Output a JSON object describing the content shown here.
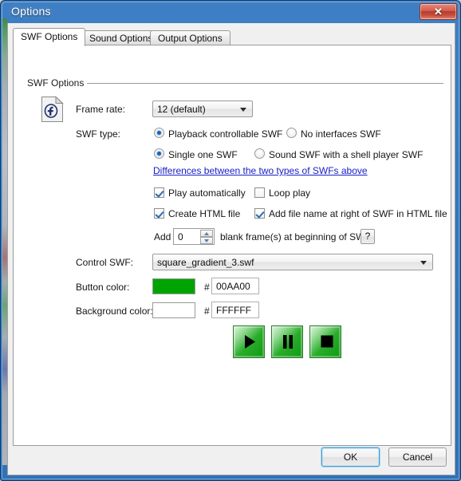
{
  "window": {
    "title": "Options",
    "close_label": "✕"
  },
  "tabs": [
    {
      "label": "SWF Options",
      "active": true
    },
    {
      "label": "Sound Options",
      "active": false
    },
    {
      "label": "Output Options",
      "active": false
    }
  ],
  "group": {
    "title": "SWF Options"
  },
  "frame_rate": {
    "label": "Frame rate:",
    "value": "12 (default)"
  },
  "swf_type": {
    "label": "SWF type:",
    "options": [
      {
        "label": "Playback controllable SWF",
        "checked": true
      },
      {
        "label": "No interfaces SWF",
        "checked": false
      },
      {
        "label": "Single one SWF",
        "checked": true
      },
      {
        "label": "Sound SWF with a shell player SWF",
        "checked": false
      }
    ],
    "link": "Differences between the two types of SWFs above"
  },
  "checkboxes": [
    {
      "label": "Play automatically",
      "checked": true
    },
    {
      "label": "Loop play",
      "checked": false
    },
    {
      "label": "Create HTML file",
      "checked": true
    },
    {
      "label": "Add file name at right of SWF in HTML file",
      "checked": true
    }
  ],
  "blank_frames": {
    "prefix": "Add",
    "value": "0",
    "suffix": "blank frame(s) at beginning of SWF",
    "help_label": "?"
  },
  "control_swf": {
    "label": "Control SWF:",
    "value": "square_gradient_3.swf"
  },
  "button_color": {
    "label": "Button color:",
    "hash": "#",
    "hex": "00AA00",
    "swatch": "#00A400"
  },
  "background_color": {
    "label": "Background color:",
    "hash": "#",
    "hex": "FFFFFF",
    "swatch": "#FFFFFF"
  },
  "preview_buttons": [
    {
      "name": "play",
      "glyph": "play-icon"
    },
    {
      "name": "pause",
      "glyph": "pause-icon"
    },
    {
      "name": "stop",
      "glyph": "stop-icon"
    }
  ],
  "footer": {
    "ok_label": "OK",
    "cancel_label": "Cancel"
  }
}
